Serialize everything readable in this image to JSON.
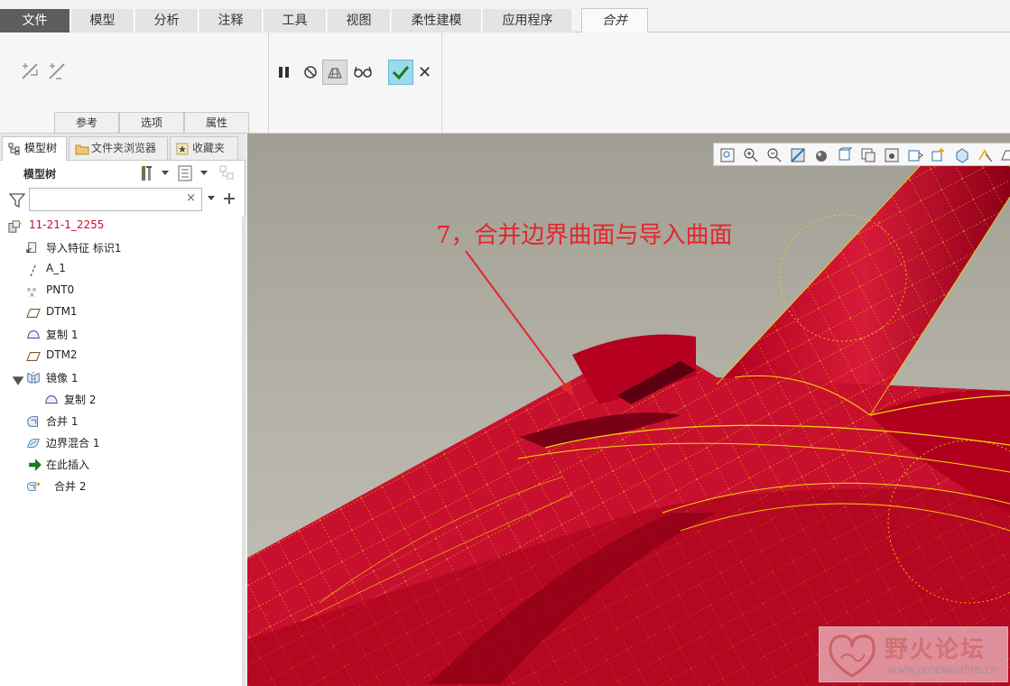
{
  "menu": {
    "tabs": [
      "文件",
      "模型",
      "分析",
      "注释",
      "工具",
      "视图",
      "柔性建模",
      "应用程序",
      "合并"
    ],
    "active": "合并"
  },
  "ribbon": {
    "subtabs": [
      "参考",
      "选项",
      "属性"
    ],
    "tool_icons": [
      "swap-direction-1-icon",
      "swap-direction-2-icon",
      "pause-icon",
      "no-preview-icon",
      "preview-geometry-icon",
      "verify-glasses-icon",
      "ok-check-icon",
      "cancel-x-icon"
    ]
  },
  "left_panel": {
    "tabs": [
      "模型树",
      "文件夹浏览器",
      "收藏夹"
    ],
    "heading": "模型树",
    "search": {
      "value": "",
      "clear": "×"
    },
    "tree": [
      {
        "label": "11-21-1_2255",
        "icon": "part-icon",
        "level": 0
      },
      {
        "label": "导入特征 标识1",
        "icon": "import-feature-icon",
        "level": 1
      },
      {
        "label": "A_1",
        "icon": "axis-icon",
        "level": 1
      },
      {
        "label": "PNT0",
        "icon": "datum-point-icon",
        "level": 1
      },
      {
        "label": "DTM1",
        "icon": "datum-plane-icon",
        "level": 1
      },
      {
        "label": "复制 1",
        "icon": "copy-surface-icon",
        "level": 1
      },
      {
        "label": "DTM2",
        "icon": "datum-plane-icon",
        "level": 1
      },
      {
        "label": "镜像 1",
        "icon": "mirror-icon",
        "level": 1,
        "expanded": true
      },
      {
        "label": "复制 2",
        "icon": "copy-surface-icon",
        "level": 2
      },
      {
        "label": "合并 1",
        "icon": "merge-icon",
        "level": 1
      },
      {
        "label": "边界混合 1",
        "icon": "boundary-blend-icon",
        "level": 1
      },
      {
        "label": "在此插入",
        "icon": "insert-here-arrow-icon",
        "level": 1
      },
      {
        "label": "合并 2",
        "icon": "merge-icon",
        "level": 1
      }
    ]
  },
  "viewport": {
    "annotation": "7，合并边界曲面与导入曲面",
    "watermark_title": "野火论坛",
    "watermark_url": "www.proewildfire.cn",
    "colors": {
      "surface": "#c8102e",
      "edges": "#f5d90a",
      "background": "#b2afa5"
    }
  }
}
